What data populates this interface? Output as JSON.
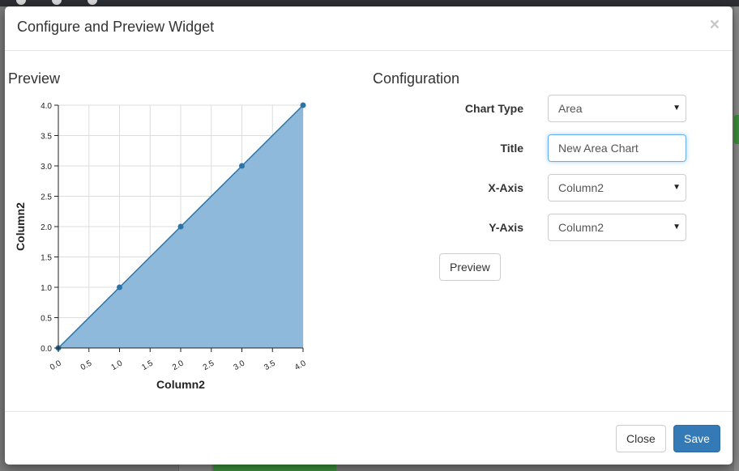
{
  "modal": {
    "title": "Configure and Preview Widget",
    "close_glyph": "×"
  },
  "preview": {
    "heading": "Preview"
  },
  "config": {
    "heading": "Configuration",
    "chart_type_label": "Chart Type",
    "chart_type_value": "Area",
    "title_label": "Title",
    "title_value": "New Area Chart",
    "xaxis_label": "X-Axis",
    "xaxis_value": "Column2",
    "yaxis_label": "Y-Axis",
    "yaxis_value": "Column2",
    "preview_button": "Preview"
  },
  "footer": {
    "close_button": "Close",
    "save_button": "Save"
  },
  "colors": {
    "area_fill": "#8fb9db",
    "line": "#2b74a8",
    "primary": "#337ab7"
  },
  "chart_data": {
    "type": "area",
    "xlabel": "Column2",
    "ylabel": "Column2",
    "x": [
      0,
      1,
      2,
      3,
      4
    ],
    "series": [
      {
        "values": [
          0,
          1,
          2,
          3,
          4
        ]
      }
    ],
    "xlim": [
      0,
      4
    ],
    "ylim": [
      0,
      4
    ],
    "xticks": [
      "0.0",
      "0.5",
      "1.0",
      "1.5",
      "2.0",
      "2.5",
      "3.0",
      "3.5",
      "4.0"
    ],
    "yticks": [
      "0.0",
      "0.5",
      "1.0",
      "1.5",
      "2.0",
      "2.5",
      "3.0",
      "3.5",
      "4.0"
    ],
    "grid": true
  }
}
